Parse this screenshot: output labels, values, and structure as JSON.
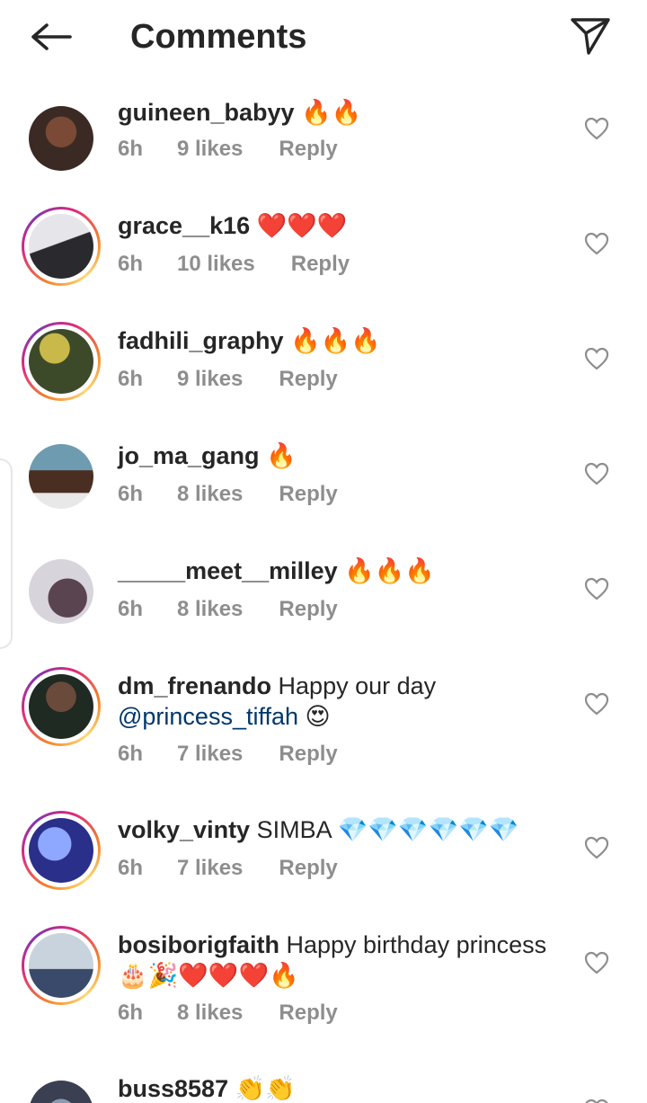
{
  "header": {
    "title": "Comments",
    "back_icon": "arrow-left-icon",
    "share_icon": "paper-plane-icon"
  },
  "comments": [
    {
      "username": "guineen_babyy",
      "text": " 🔥🔥",
      "time": "6h",
      "likes": "9 likes",
      "reply": "Reply",
      "story": false,
      "avatar_colors": [
        "#3b2a24",
        "#7a4a36"
      ]
    },
    {
      "username": "grace__k16",
      "text": " ❤️❤️❤️",
      "time": "6h",
      "likes": "10 likes",
      "reply": "Reply",
      "story": true,
      "avatar_colors": [
        "#d9d9dd",
        "#2a2a2e"
      ]
    },
    {
      "username": "fadhili_graphy",
      "text": " 🔥🔥🔥",
      "time": "6h",
      "likes": "9 likes",
      "reply": "Reply",
      "story": true,
      "avatar_colors": [
        "#3d4a2a",
        "#c9b94a"
      ]
    },
    {
      "username": "jo_ma_gang",
      "text": " 🔥",
      "time": "6h",
      "likes": "8 likes",
      "reply": "Reply",
      "story": false,
      "avatar_colors": [
        "#6f9bb0",
        "#4a2e22"
      ]
    },
    {
      "username": "_____meet__milley",
      "text": " 🔥🔥🔥",
      "time": "6h",
      "likes": "8 likes",
      "reply": "Reply",
      "story": false,
      "avatar_colors": [
        "#d8d4dc",
        "#5a4450"
      ]
    },
    {
      "username": "dm_frenando",
      "text": " Happy our day",
      "mention": "@princess_tiffah",
      "trail": " 😍",
      "time": "6h",
      "likes": "7 likes",
      "reply": "Reply",
      "story": true,
      "avatar_colors": [
        "#1e2a22",
        "#6a4a3a"
      ]
    },
    {
      "username": "volky_vinty",
      "text": " SIMBA 💎💎💎💎💎💎",
      "time": "6h",
      "likes": "7 likes",
      "reply": "Reply",
      "story": true,
      "avatar_colors": [
        "#2a2f8a",
        "#8ea7ff"
      ]
    },
    {
      "username": "bosiborigfaith",
      "text": " Happy birthday princess 🎂🎉❤️❤️❤️🔥",
      "time": "6h",
      "likes": "8 likes",
      "reply": "Reply",
      "story": true,
      "avatar_colors": [
        "#c9d3dd",
        "#3a4a6a"
      ]
    },
    {
      "username": "buss8587",
      "text": " 👏👏",
      "time": "",
      "likes": "",
      "reply": "",
      "story": false,
      "avatar_colors": [
        "#3a3f52",
        "#8a9bb0"
      ]
    }
  ]
}
